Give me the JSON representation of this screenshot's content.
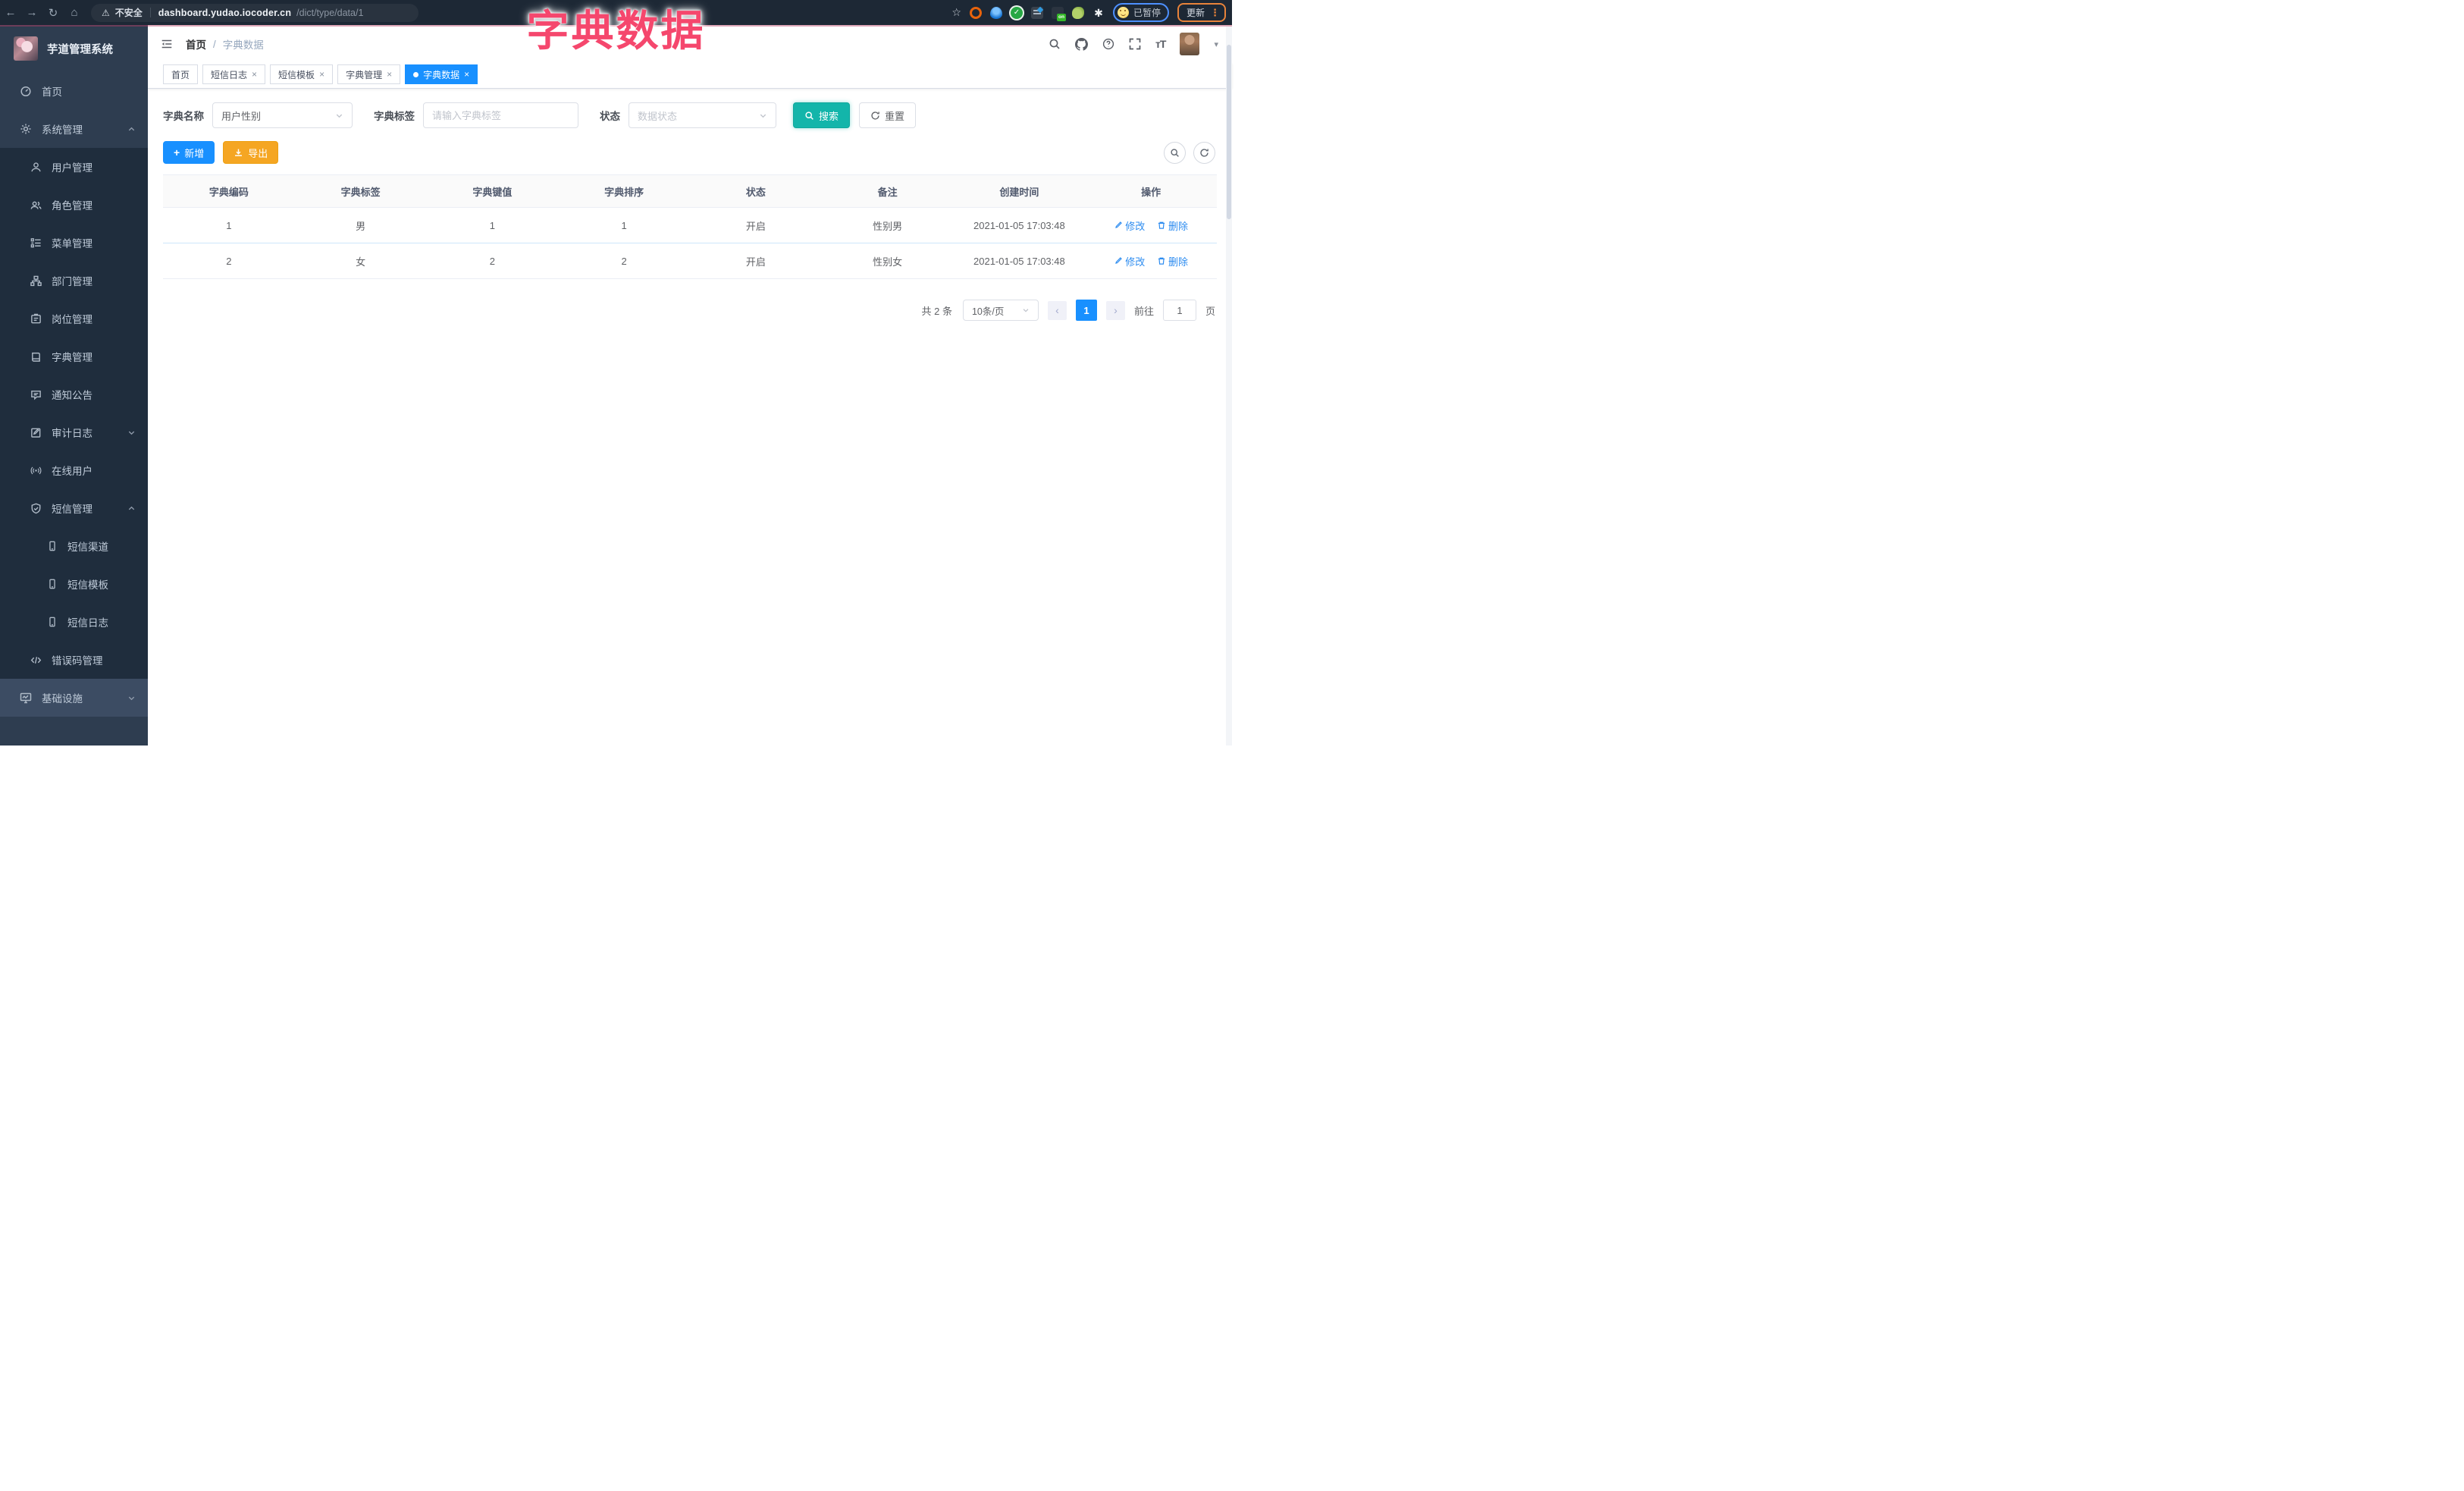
{
  "browser": {
    "back_glyph": "←",
    "forward_glyph": "→",
    "reload_glyph": "↻",
    "home_glyph": "⌂",
    "warning_glyph": "⚠",
    "security_label": "不安全",
    "url_host": "dashboard.yudao.iocoder.cn",
    "url_path": "/dict/type/data/1",
    "star_glyph": "☆",
    "on_badge": "on",
    "snow_glyph": "✱",
    "paused_label": "已暂停",
    "update_label": "更新",
    "menu_glyph": "⋮"
  },
  "overlay_title": "字典数据",
  "sidebar": {
    "logo_title": "芋道管理系统",
    "items": [
      {
        "label": "首页"
      },
      {
        "label": "系统管理"
      },
      {
        "label": "用户管理"
      },
      {
        "label": "角色管理"
      },
      {
        "label": "菜单管理"
      },
      {
        "label": "部门管理"
      },
      {
        "label": "岗位管理"
      },
      {
        "label": "字典管理"
      },
      {
        "label": "通知公告"
      },
      {
        "label": "审计日志"
      },
      {
        "label": "在线用户"
      },
      {
        "label": "短信管理"
      },
      {
        "label": "短信渠道"
      },
      {
        "label": "短信模板"
      },
      {
        "label": "短信日志"
      },
      {
        "label": "错误码管理"
      },
      {
        "label": "基础设施"
      }
    ]
  },
  "header": {
    "breadcrumb_home": "首页",
    "breadcrumb_sep": "/",
    "breadcrumb_current": "字典数据",
    "caret_glyph": "▾"
  },
  "tabs": [
    {
      "label": "首页"
    },
    {
      "label": "短信日志",
      "close": "×"
    },
    {
      "label": "短信模板",
      "close": "×"
    },
    {
      "label": "字典管理",
      "close": "×"
    },
    {
      "label": "字典数据",
      "close": "×"
    }
  ],
  "filters": {
    "dict_name_label": "字典名称",
    "dict_name_value": "用户性别",
    "dict_label_label": "字典标签",
    "dict_label_placeholder": "请输入字典标签",
    "status_label": "状态",
    "status_placeholder": "数据状态",
    "search_label": "搜索",
    "reset_label": "重置"
  },
  "toolbar": {
    "add_glyph": "+",
    "add_label": "新增",
    "export_label": "导出"
  },
  "table": {
    "columns": [
      "字典编码",
      "字典标签",
      "字典键值",
      "字典排序",
      "状态",
      "备注",
      "创建时间",
      "操作"
    ],
    "rows": [
      [
        "1",
        "男",
        "1",
        "1",
        "开启",
        "性别男",
        "2021-01-05 17:03:48"
      ],
      [
        "2",
        "女",
        "2",
        "2",
        "开启",
        "性别女",
        "2021-01-05 17:03:48"
      ]
    ],
    "edit_label": "修改",
    "delete_label": "删除"
  },
  "pagination": {
    "total": "共 2 条",
    "page_size": "10条/页",
    "prev_glyph": "‹",
    "next_glyph": "›",
    "current_page": "1",
    "goto_label": "前往",
    "goto_value": "1",
    "page_unit": "页"
  },
  "colors": {
    "primary_blue": "#1890ff",
    "search_teal": "#13b5aa",
    "export_orange": "#f5a623",
    "overlay_pink": "#f5476d",
    "chrome_bg": "#1d2835",
    "sidebar_bg": "#2e3d50",
    "submenu_bg": "#1f2d3d",
    "infra_row_bg": "#3c4c63",
    "active_tab_bg": "#1890ff",
    "row_divider_blue": "#cde6fa"
  }
}
